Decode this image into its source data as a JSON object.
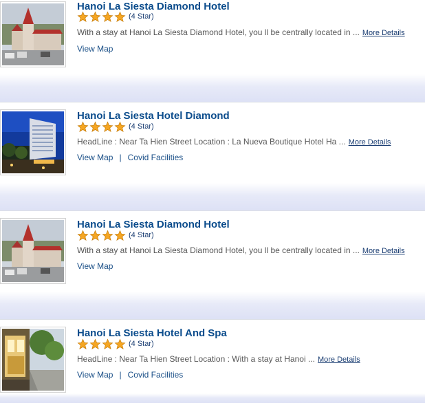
{
  "hotels": [
    {
      "name": "Hanoi La Siesta Diamond Hotel",
      "rating_stars": 4,
      "rating_label": "(4 Star)",
      "description": "With a stay at Hanoi La Siesta Diamond Hotel, you ll be centrally located in ...",
      "more_label": "More Details",
      "links": [
        "View Map"
      ],
      "image_icon": "hotel-building-photo"
    },
    {
      "name": "Hanoi La Siesta Hotel Diamond",
      "rating_stars": 4,
      "rating_label": "(4 Star)",
      "description": "HeadLine : Near Ta Hien Street Location : La Nueva Boutique Hotel Ha ...",
      "more_label": "More Details",
      "links": [
        "View Map",
        "Covid Facilities"
      ],
      "image_icon": "hotel-night-photo"
    },
    {
      "name": "Hanoi La Siesta Diamond Hotel",
      "rating_stars": 4,
      "rating_label": "(4 Star)",
      "description": "With a stay at Hanoi La Siesta Diamond Hotel, you ll be centrally located in ...",
      "more_label": "More Details",
      "links": [
        "View Map"
      ],
      "image_icon": "hotel-building-photo"
    },
    {
      "name": "Hanoi La Siesta Hotel And Spa",
      "rating_stars": 4,
      "rating_label": "(4 Star)",
      "description": "HeadLine : Near Ta Hien Street Location : With a stay at Hanoi ...",
      "more_label": "More Details",
      "links": [
        "View Map",
        "Covid Facilities"
      ],
      "image_icon": "hotel-street-photo"
    }
  ],
  "colors": {
    "title": "#0b4c8c",
    "link": "#1a4f87",
    "star": "#f5a623",
    "separator": "#e2e5f7"
  }
}
